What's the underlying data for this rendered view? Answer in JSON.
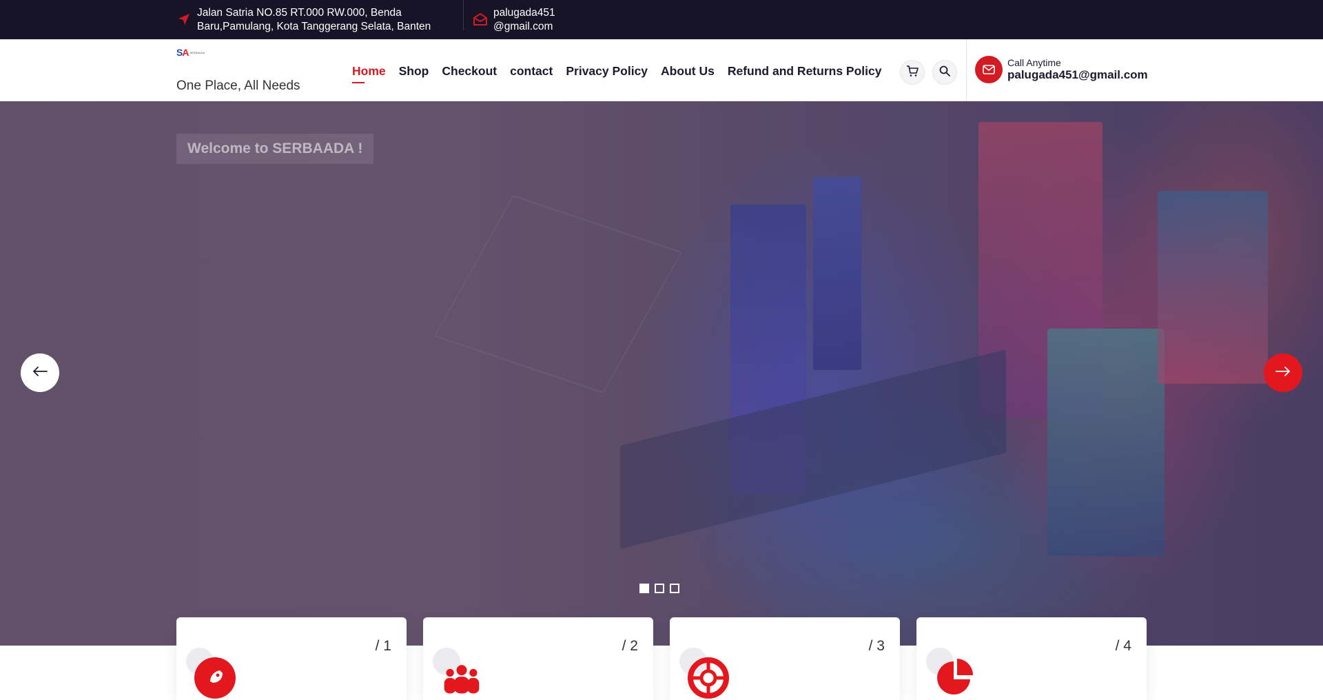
{
  "topbar": {
    "address_line1": "Jalan Satria NO.85 RT.000 RW.000, Benda",
    "address_line2": "Baru,Pamulang, Kota Tanggerang Selata, Banten",
    "email_line1": "palugada451",
    "email_line2": "@gmail.com",
    "icons": {
      "address": "location-arrow-icon",
      "email": "envelope-open-icon"
    },
    "accent": "#d21b22"
  },
  "header": {
    "tagline": "One Place, All Needs",
    "nav": [
      {
        "label": "Home",
        "active": true
      },
      {
        "label": "Shop"
      },
      {
        "label": "Checkout"
      },
      {
        "label": "contact"
      },
      {
        "label": "Privacy Policy"
      },
      {
        "label": "About Us"
      },
      {
        "label": "Refund and Returns Policy"
      }
    ],
    "call_label": "Call Anytime",
    "call_value": "palugada451@gmail.com",
    "icons": {
      "cart": "cart-icon",
      "search": "search-icon",
      "mail": "envelope-icon"
    }
  },
  "hero": {
    "welcome": "Welcome to SERBAADA !",
    "slides": 3,
    "active_slide": 1
  },
  "cards": [
    {
      "number": "/ 1",
      "icon": "rocket-icon"
    },
    {
      "number": "/ 2",
      "icon": "users-icon"
    },
    {
      "number": "/ 3",
      "icon": "lifebuoy-icon"
    },
    {
      "number": "/ 4",
      "icon": "pie-chart-icon"
    }
  ]
}
